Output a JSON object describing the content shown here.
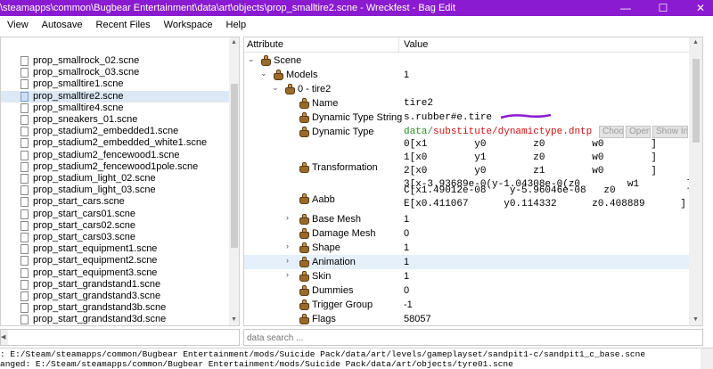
{
  "window": {
    "title": "\\steamapps\\common\\Bugbear Entertainment\\data\\art\\objects\\prop_smalltire2.scne - Wreckfest - Bag Edit",
    "minimize": "—",
    "maximize": "☐",
    "close": "✕"
  },
  "menu": [
    "View",
    "Autosave",
    "Recent Files",
    "Workspace",
    "Help"
  ],
  "file_list": [
    "prop_smallrock_02.scne",
    "prop_smallrock_03.scne",
    "prop_smalltire1.scne",
    "prop_smalltire2.scne",
    "prop_smalltire4.scne",
    "prop_sneakers_01.scne",
    "prop_stadium2_embedded1.scne",
    "prop_stadium2_embedded_white1.scne",
    "prop_stadium2_fencewood1.scne",
    "prop_stadium2_fencewood1pole.scne",
    "prop_stadium_light_02.scne",
    "prop_stadium_light_03.scne",
    "prop_start_cars.scne",
    "prop_start_cars01.scne",
    "prop_start_cars02.scne",
    "prop_start_cars03.scne",
    "prop_start_equipment1.scne",
    "prop_start_equipment2.scne",
    "prop_start_equipment3.scne",
    "prop_start_grandstand1.scne",
    "prop_start_grandstand3.scne",
    "prop_start_grandstand3b.scne",
    "prop_start_grandstand3d.scne"
  ],
  "selected_file": "prop_smalltire2.scne",
  "tree": {
    "col_attribute": "Attribute",
    "col_value": "Value",
    "scene": "Scene",
    "models": "Models",
    "models_value": "1",
    "tire": "0 - tire2",
    "name_label": "Name",
    "name_value": "tire2",
    "dts_label": "Dynamic Type String",
    "dts_value": "s.rubber#e.tire",
    "dt_label": "Dynamic Type",
    "dt_prefix": "data/",
    "dt_path": "substitute/dynamictype.dntp",
    "btn_choose": "Choo",
    "btn_open": "Open",
    "btn_show": "Show In E",
    "transform_label": "Transformation",
    "transform_rows": [
      "0[x1        y0        z0        w0        ]",
      "1[x0        y1        z0        w0        ]",
      "2[x0        y0        z1        w0        ]",
      "3[x-3.93689e-0(y-1.04308e-0(z0        w1        ]"
    ],
    "aabb_label": "Aabb",
    "aabb_rows": [
      "C[x1.49012e-08    y-5.96046e-08   z0             ]",
      "E[x0.411067      y0.114332      z0.408889      ]"
    ],
    "base_mesh": "Base Mesh",
    "base_mesh_value": "1",
    "damage_mesh": "Damage Mesh",
    "damage_mesh_value": "0",
    "shape": "Shape",
    "shape_value": "1",
    "animation": "Animation",
    "animation_value": "1",
    "skin": "Skin",
    "skin_value": "1",
    "dummies": "Dummies",
    "dummies_value": "0",
    "trigger_group": "Trigger Group",
    "trigger_group_value": "-1",
    "flags": "Flags",
    "flags_value": "58057"
  },
  "search": {
    "placeholder": "data search ..."
  },
  "log": [
    ": E:/Steam/steamapps/common/Bugbear Entertainment/mods/Suicide Pack/data/art/levels/gameplayset/sandpit1-c/sandpit1_c_base.scne",
    "anged: E:/Steam/steamapps/common/Bugbear Entertainment/mods/Suicide Pack/data/art/objects/tyre01.scne"
  ],
  "colors": {
    "titlebar": "#8a1bd0",
    "green_text": "#2e8b2e",
    "red_text": "#d01010",
    "highlight": "#e5f0fb",
    "scribble": "#8a1bd0"
  }
}
